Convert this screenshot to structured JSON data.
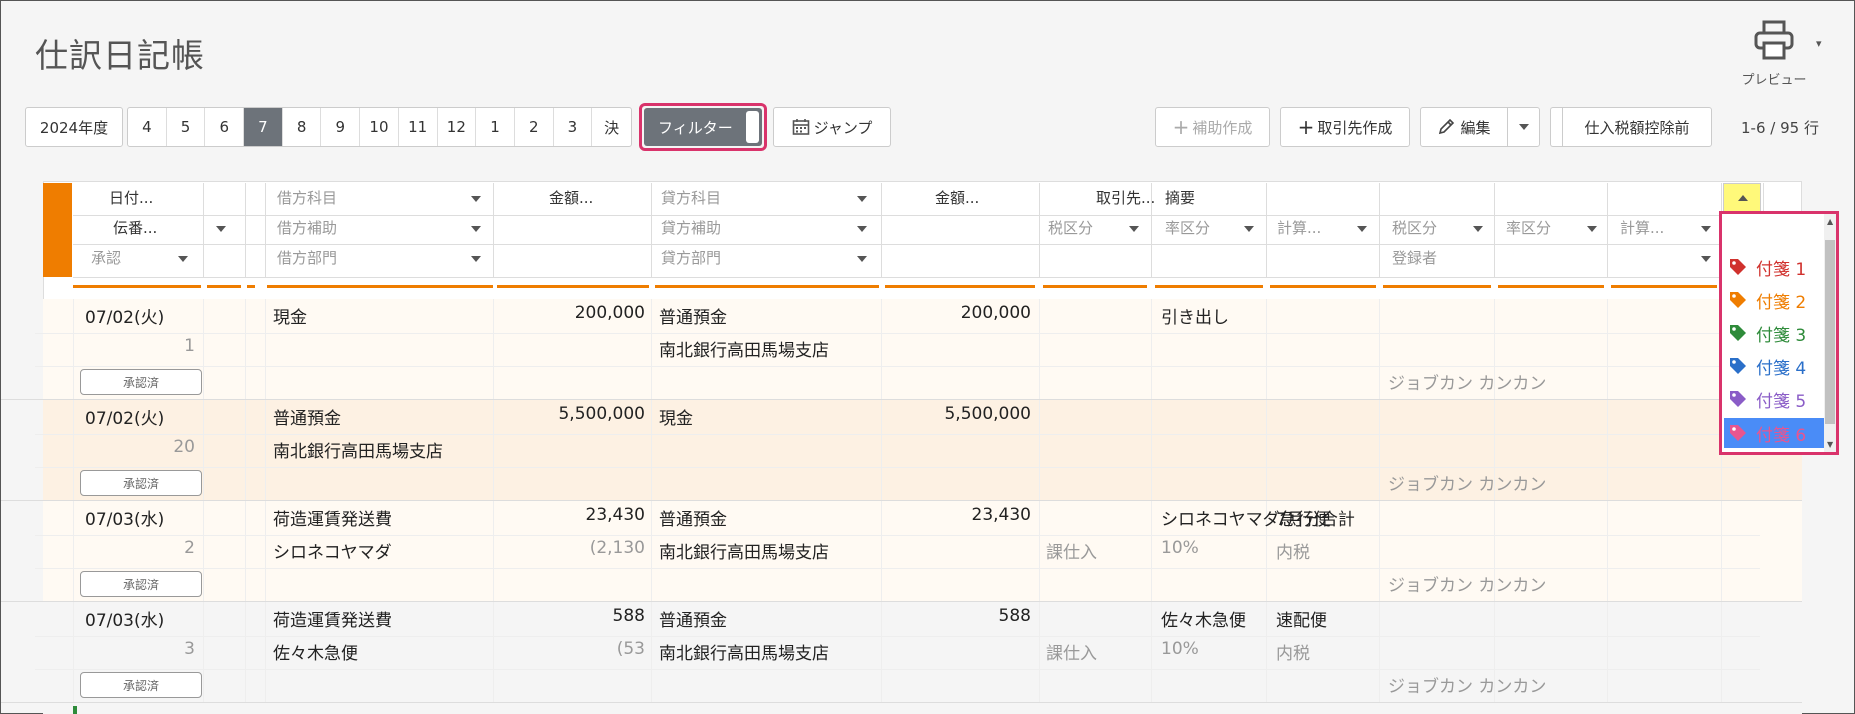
{
  "page": {
    "title": "仕訳日記帳"
  },
  "header": {
    "preview_label": "プレビュー"
  },
  "toolbar": {
    "year": "2024年度",
    "months": [
      "4",
      "5",
      "6",
      "7",
      "8",
      "9",
      "10",
      "11",
      "12",
      "1",
      "2",
      "3",
      "決"
    ],
    "active_month": "7",
    "filter_label": "フィルター",
    "jump_label": "ジャンプ",
    "sub_create_label": "補助作成",
    "partner_create_label": "取引先作成",
    "edit_label": "編集",
    "tax_label": "仕入税額控除前",
    "page_info": "1-6 / 95 行"
  },
  "columns": {
    "date": "日付...",
    "voucher": "伝番...",
    "approval": "承認",
    "debit_account": "借方科目",
    "debit_sub": "借方補助",
    "debit_dept": "借方部門",
    "amount": "金額...",
    "credit_account": "貸方科目",
    "credit_sub": "貸方補助",
    "credit_dept": "貸方部門",
    "partner": "取引先...",
    "summary": "摘要",
    "tax_class": "税区分",
    "rate_class": "率区分",
    "calc": "計算...",
    "registrant": "登録者"
  },
  "rows": [
    {
      "date": "07/02(火)",
      "voucher": "1",
      "status": "承認済",
      "debit": "現金",
      "debit_sub": "",
      "debit_amount": "200,000",
      "debit_tax": "",
      "credit": "普通預金",
      "credit_sub": "南北銀行高田馬場支店",
      "credit_amount": "200,000",
      "summary1": "引き出し",
      "summary2": "",
      "tax_class": "",
      "rate": "",
      "calc": "",
      "registrant": "ジョブカン カンカン"
    },
    {
      "date": "07/02(火)",
      "voucher": "20",
      "status": "承認済",
      "debit": "普通預金",
      "debit_sub": "南北銀行高田馬場支店",
      "debit_amount": "5,500,000",
      "debit_tax": "",
      "credit": "現金",
      "credit_sub": "",
      "credit_amount": "5,500,000",
      "summary1": "",
      "summary2": "",
      "tax_class": "",
      "rate": "",
      "calc": "",
      "registrant": "ジョブカン カンカン"
    },
    {
      "date": "07/03(水)",
      "voucher": "2",
      "status": "承認済",
      "debit": "荷造運賃発送費",
      "debit_sub": "シロネコヤマダ",
      "debit_amount": "23,430",
      "debit_tax": "(2,130",
      "credit": "普通預金",
      "credit_sub": "南北銀行高田馬場支店",
      "credit_amount": "23,430",
      "summary1": "シロネコヤマダ急行便",
      "summary2": "7月分合計",
      "tax_class": "課仕入",
      "rate": "10%",
      "calc": "内税",
      "registrant": "ジョブカン カンカン"
    },
    {
      "date": "07/03(水)",
      "voucher": "3",
      "status": "承認済",
      "debit": "荷造運賃発送費",
      "debit_sub": "佐々木急便",
      "debit_amount": "588",
      "debit_tax": "(53",
      "credit": "普通預金",
      "credit_sub": "南北銀行高田馬場支店",
      "credit_amount": "588",
      "summary1": "佐々木急便",
      "summary2": "速配便",
      "tax_class": "課仕入",
      "rate": "10%",
      "calc": "内税",
      "registrant": "ジョブカン カンカン"
    }
  ],
  "dropdown": {
    "items": [
      {
        "label": "付箋 1",
        "color": "#d0312d"
      },
      {
        "label": "付箋 2",
        "color": "#ef7d00"
      },
      {
        "label": "付箋 3",
        "color": "#2e8b3a"
      },
      {
        "label": "付箋 4",
        "color": "#2a6fc9"
      },
      {
        "label": "付箋 5",
        "color": "#8a5cc7"
      },
      {
        "label": "付箋 6",
        "color": "#e8558f"
      }
    ],
    "selected_index": 5
  },
  "colors": {
    "accent": "#ef7d00",
    "highlight": "#d9336b",
    "active_month": "#6d737a"
  }
}
